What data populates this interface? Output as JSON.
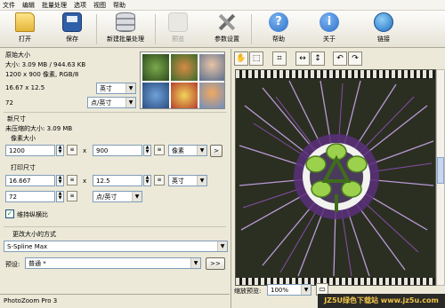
{
  "menu": [
    "文件",
    "编辑",
    "批量处理",
    "选项",
    "视图",
    "帮助"
  ],
  "toolbar": {
    "open": "打开",
    "save": "保存",
    "new_batch": "新建批量处理",
    "preview": "预览",
    "settings": "参数设置",
    "help": "帮助",
    "about": "关于",
    "link": "链接"
  },
  "original": {
    "title": "原始大小",
    "size_text": "大小: 3.09 MB / 944.63 KB",
    "pixels_text": "1200 x 900 像素, RGB/8",
    "dims_value": "16.67 x 12.5",
    "dims_unit": "英寸",
    "res_value": "72",
    "res_unit": "点/英寸"
  },
  "new_size": {
    "title": "新尺寸",
    "uncompressed": "未压缩的大小: 3.09 MB",
    "pixel_label": "像素大小",
    "width_px": "1200",
    "height_px": "900",
    "pixel_unit": "像素",
    "more_btn": ">",
    "print_label": "打印尺寸",
    "width_in": "16.667",
    "height_in": "12.5",
    "print_unit": "英寸",
    "res": "72",
    "res_unit": "点/英寸",
    "times": "x",
    "keep_ratio": "维持纵横比"
  },
  "method": {
    "title": "更改大小的方式",
    "value": "S-Spline Max",
    "preset_label": "预设:",
    "preset_value": "普通 *",
    "preset_btn": ">>"
  },
  "zoom": {
    "label": "缩放预览:",
    "value": "100%"
  },
  "status": {
    "app": "PhotoZoom Pro 3"
  },
  "watermark": "JZ5U绿色下载站 www.jz5u.com",
  "colors": {
    "accent_blue": "#2a6fc9",
    "flower_purple": "#8a4fae",
    "flower_green": "#9bd14d"
  }
}
